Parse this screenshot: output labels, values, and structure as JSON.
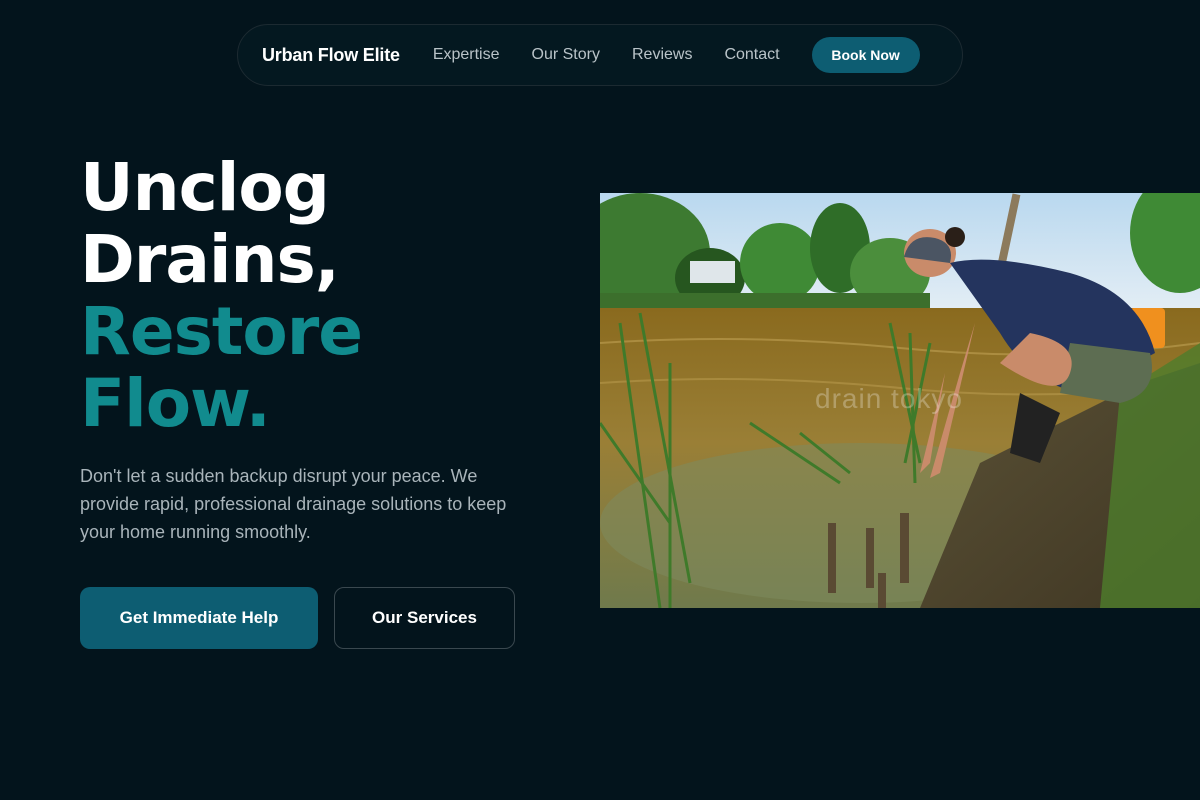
{
  "nav": {
    "brand": "Urban Flow Elite",
    "links": [
      "Expertise",
      "Our Story",
      "Reviews",
      "Contact"
    ],
    "cta": "Book Now"
  },
  "hero": {
    "title_lines": [
      "Unclog",
      "Drains,"
    ],
    "accent_lines": [
      "Restore",
      "Flow."
    ],
    "description": "Don't let a sudden backup disrupt your peace. We provide rapid, professional drainage solutions to keep your home running smoothly.",
    "primary_button": "Get Immediate Help",
    "secondary_button": "Our Services",
    "image_watermark": "drain tokyo"
  },
  "colors": {
    "background": "#03141c",
    "accent": "#118b8e",
    "button": "#0d5d72"
  }
}
